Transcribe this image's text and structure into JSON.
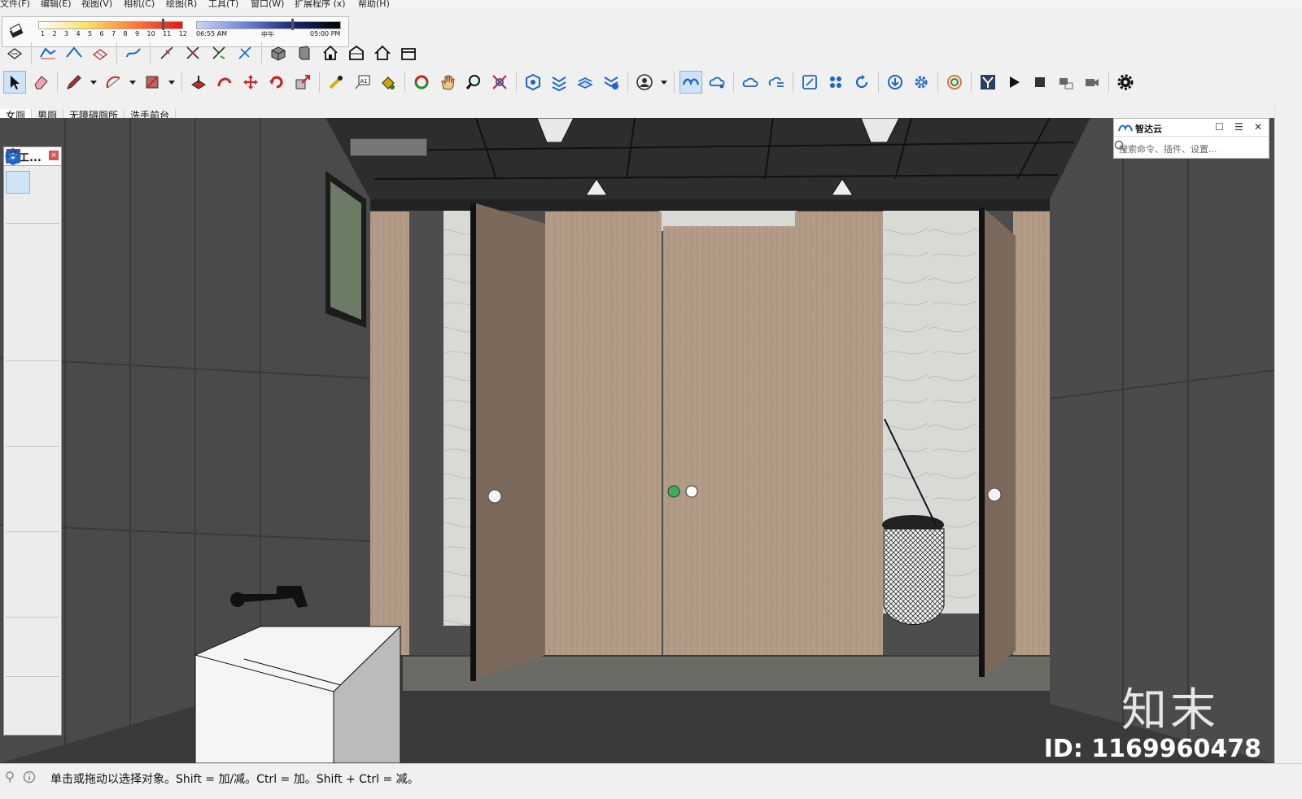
{
  "menu": [
    "文件(F)",
    "编辑(E)",
    "视图(V)",
    "相机(C)",
    "绘图(R)",
    "工具(T)",
    "窗口(W)",
    "扩展程序 (x)",
    "帮助(H)"
  ],
  "shadow": {
    "months": [
      "1",
      "2",
      "3",
      "4",
      "5",
      "6",
      "7",
      "8",
      "9",
      "10",
      "11",
      "12"
    ],
    "time_start": "06:55 AM",
    "time_mid": "中午",
    "time_end": "05:00 PM"
  },
  "scenes": [
    "女厕",
    "男厕",
    "无障碍厕所",
    "洗手前台"
  ],
  "large_tool": {
    "title": "大工..."
  },
  "zhida": {
    "title": "智达云",
    "search_placeholder": "搜索命令、插件、设置..."
  },
  "status": {
    "text": "单击或拖动以选择对象。Shift = 加/减。Ctrl = 加。Shift + Ctrl = 减。"
  },
  "watermark": {
    "logo": "知末",
    "id": "ID: 1169960478"
  },
  "colors": {
    "partition": "#b29c88",
    "door_open": "#7b6a5c",
    "wall": "#4a4a4a",
    "floor": "#3a3a3a"
  }
}
